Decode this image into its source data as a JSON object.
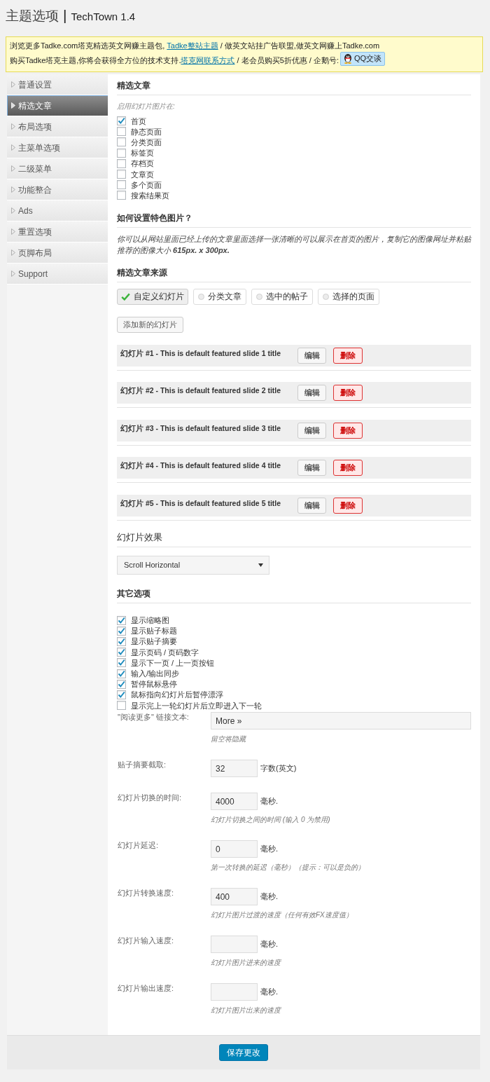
{
  "header": {
    "title": "主题选项",
    "separator": "|",
    "theme_name": "TechTown 1.4"
  },
  "notice": {
    "lines": [
      {
        "segments": [
          {
            "kind": "text",
            "text": "浏览更多Tadke.com塔克精选英文网赚主题包, "
          },
          {
            "kind": "link",
            "text": "Tadke整站主题"
          },
          {
            "kind": "text",
            "text": " / 做英文站挂广告联盟,做英文网赚上Tadke.com"
          }
        ]
      },
      {
        "segments": [
          {
            "kind": "text",
            "text": "购买Tadke塔克主题,你将会获得全方位的技术支持."
          },
          {
            "kind": "link",
            "text": "塔克网联系方式"
          },
          {
            "kind": "text",
            "text": " / 老会员购买5折优惠 / 企鹅号:"
          }
        ],
        "button": "QQ交谈"
      }
    ]
  },
  "sidebar": {
    "items": [
      {
        "label": "普通设置",
        "selected": false
      },
      {
        "label": "精选文章",
        "selected": true
      },
      {
        "label": "布局选项",
        "selected": false
      },
      {
        "label": "主菜单选项",
        "selected": false
      },
      {
        "label": "二级菜单",
        "selected": false
      },
      {
        "label": "功能整合",
        "selected": false
      },
      {
        "label": "Ads",
        "selected": false
      },
      {
        "label": "重置选项",
        "selected": false
      },
      {
        "label": "页脚布局",
        "selected": false
      },
      {
        "label": "Support",
        "selected": false
      }
    ]
  },
  "sections": [
    {
      "kind": "checklist",
      "heading": "精选文章",
      "note": "启用幻灯片图片在:",
      "options": [
        {
          "label": "首页",
          "checked": true
        },
        {
          "label": "静态页面",
          "checked": false
        },
        {
          "label": "分类页面",
          "checked": false
        },
        {
          "label": "标签页",
          "checked": false
        },
        {
          "label": "存档页",
          "checked": false
        },
        {
          "label": "文章页",
          "checked": false
        },
        {
          "label": "多个页面",
          "checked": false
        },
        {
          "label": "搜索结果页",
          "checked": false
        }
      ]
    },
    {
      "kind": "text",
      "heading": "如何设置特色图片？",
      "paragraph": "你可以从网站里面已经上传的文章里面选择一张清晰的可以展示在首页的图片，复制它的图像网址并粘贴推荐的图像大小 **615px. x 300px.**"
    },
    {
      "kind": "source",
      "heading": "精选文章来源",
      "options": [
        {
          "label": "自定义幻灯片",
          "selected": true
        },
        {
          "label": "分类文章",
          "selected": false
        },
        {
          "label": "选中的帖子",
          "selected": false
        },
        {
          "label": "选择的页面",
          "selected": false
        }
      ],
      "add_button": "添加新的幻灯片",
      "slides": [
        {
          "title": "幻灯片 #1 - This is default featured slide 1 title",
          "edit_button": "编辑",
          "delete_button": "删除"
        },
        {
          "title": "幻灯片 #2 - This is default featured slide 2 title",
          "edit_button": "编辑",
          "delete_button": "删除"
        },
        {
          "title": "幻灯片 #3 - This is default featured slide 3 title",
          "edit_button": "编辑",
          "delete_button": "删除"
        },
        {
          "title": "幻灯片 #4 - This is default featured slide 4 title",
          "edit_button": "编辑",
          "delete_button": "删除"
        },
        {
          "title": "幻灯片 #5 - This is default featured slide 5 title",
          "edit_button": "编辑",
          "delete_button": "删除"
        }
      ]
    },
    {
      "kind": "select",
      "heading": "幻灯片效果",
      "value": "Scroll Horizontal"
    },
    {
      "kind": "options",
      "heading": "其它选项",
      "options": [
        {
          "label": "显示缩略图",
          "checked": true
        },
        {
          "label": "显示贴子标题",
          "checked": true
        },
        {
          "label": "显示贴子摘要",
          "checked": true
        },
        {
          "label": "显示页码 / 页码数字",
          "checked": true
        },
        {
          "label": "显示下一页 / 上一页按钮",
          "checked": true
        },
        {
          "label": "输入/输出同步",
          "checked": true
        },
        {
          "label": "暂停鼠标悬停",
          "checked": true
        },
        {
          "label": "鼠标指向幻灯片后暂停漂浮",
          "checked": true
        },
        {
          "label": "显示完上一轮幻灯片后立即进入下一轮",
          "checked": false
        }
      ],
      "fields": [
        {
          "kind": "wide",
          "label": "\"阅读更多\" 链接文本:",
          "value": "More »",
          "hint": "留空将隐藏"
        },
        {
          "kind": "short",
          "label": "贴子摘要截取:",
          "value": "32",
          "unit": "字数(英文)"
        },
        {
          "kind": "short",
          "label": "幻灯片切换的时间:",
          "value": "4000",
          "unit": "毫秒.",
          "hint": "幻灯片切换之间的时间 (输入 0 为禁用)"
        },
        {
          "kind": "short",
          "label": "幻灯片延迟:",
          "value": "0",
          "unit": "毫秒.",
          "hint": "第一次转换的延迟（毫秒）（提示：可以是负的）"
        },
        {
          "kind": "short",
          "label": "幻灯片转换速度:",
          "value": "400",
          "unit": "毫秒.",
          "hint": "幻灯片图片过渡的速度（任何有效FX速度值）"
        },
        {
          "kind": "short",
          "label": "幻灯片输入速度:",
          "unit": "毫秒.",
          "hint": "幻灯片图片进来的速度"
        },
        {
          "kind": "short",
          "label": "幻灯片输出速度:",
          "unit": "毫秒.",
          "hint": "幻灯片图片出来的速度"
        }
      ]
    }
  ],
  "footer": {
    "save_button": "保存更改"
  }
}
